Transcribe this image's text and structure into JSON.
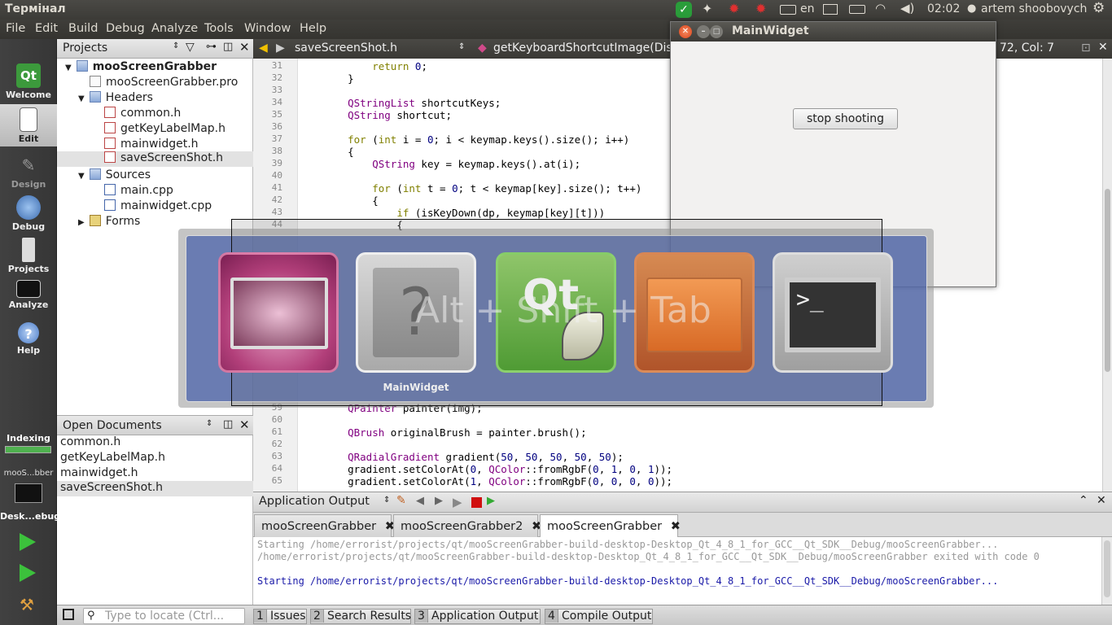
{
  "top_panel": {
    "app_title": "Термінал",
    "lang": "en",
    "time": "02:02",
    "user": "artem shoobovych"
  },
  "menu": [
    "File",
    "Edit",
    "Build",
    "Debug",
    "Analyze",
    "Tools",
    "Window",
    "Help"
  ],
  "modes": {
    "welcome": "Welcome",
    "edit": "Edit",
    "design": "Design",
    "debug": "Debug",
    "projects": "Projects",
    "analyze": "Analyze",
    "help": "Help"
  },
  "build_status": {
    "indexing": "Indexing",
    "target_project": "mooS...bber",
    "target_kit": "Desk...ebug"
  },
  "projects": {
    "title": "Projects",
    "tree": [
      {
        "label": "mooScreenGrabber"
      },
      {
        "label": "mooScreenGrabber.pro"
      },
      {
        "label": "Headers"
      },
      {
        "label": "common.h"
      },
      {
        "label": "getKeyLabelMap.h"
      },
      {
        "label": "mainwidget.h"
      },
      {
        "label": "saveScreenShot.h"
      },
      {
        "label": "Sources"
      },
      {
        "label": "main.cpp"
      },
      {
        "label": "mainwidget.cpp"
      },
      {
        "label": "Forms"
      }
    ]
  },
  "open_documents": {
    "title": "Open Documents",
    "items": [
      "common.h",
      "getKeyLabelMap.h",
      "mainwidget.h",
      "saveScreenShot.h"
    ]
  },
  "editor": {
    "file": "saveScreenShot.h",
    "symbol": "getKeyboardShortcutImage(Disp",
    "position": "72, Col: 7",
    "lines": [
      {
        "n": "31",
        "t": "        return 0;"
      },
      {
        "n": "32",
        "t": "    }"
      },
      {
        "n": "33",
        "t": ""
      },
      {
        "n": "34",
        "t": "    QStringList shortcutKeys;"
      },
      {
        "n": "35",
        "t": "    QString shortcut;"
      },
      {
        "n": "36",
        "t": ""
      },
      {
        "n": "37",
        "t": "    for (int i = 0; i < keymap.keys().size(); i++)"
      },
      {
        "n": "38",
        "t": "    {"
      },
      {
        "n": "39",
        "t": "        QString key = keymap.keys().at(i);"
      },
      {
        "n": "40",
        "t": ""
      },
      {
        "n": "41",
        "t": "        for (int t = 0; t < keymap[key].size(); t++)"
      },
      {
        "n": "42",
        "t": "        {"
      },
      {
        "n": "43",
        "t": "            if (isKeyDown(dp, keymap[key][t]))"
      },
      {
        "n": "44",
        "t": "            {"
      }
    ],
    "lines_bottom": [
      {
        "n": "59",
        "t": "    QPainter painter(img);"
      },
      {
        "n": "60",
        "t": ""
      },
      {
        "n": "61",
        "t": "    QBrush originalBrush = painter.brush();"
      },
      {
        "n": "62",
        "t": ""
      },
      {
        "n": "63",
        "t": "    QRadialGradient gradient(50, 50, 50, 50, 50);"
      },
      {
        "n": "64",
        "t": "    gradient.setColorAt(0, QColor::fromRgbF(0, 1, 0, 1));"
      },
      {
        "n": "65",
        "t": "    gradient.setColorAt(1, QColor::fromRgbF(0, 0, 0, 0));"
      }
    ]
  },
  "main_widget": {
    "title": "MainWidget",
    "button": "stop shooting"
  },
  "switcher": {
    "shortcut": "Alt + Shift + Tab",
    "selected_label": "MainWidget"
  },
  "output": {
    "title": "Application Output",
    "tabs": [
      "mooScreenGrabber",
      "mooScreenGrabber2",
      "mooScreenGrabber"
    ],
    "lines": [
      "Starting /home/errorist/projects/qt/mooScreenGrabber-build-desktop-Desktop_Qt_4_8_1_for_GCC__Qt_SDK__Debug/mooScreenGrabber...",
      "/home/errorist/projects/qt/mooScreenGrabber-build-desktop-Desktop_Qt_4_8_1_for_GCC__Qt_SDK__Debug/mooScreenGrabber exited with code 0",
      "",
      "Starting /home/errorist/projects/qt/mooScreenGrabber-build-desktop-Desktop_Qt_4_8_1_for_GCC__Qt_SDK__Debug/mooScreenGrabber..."
    ]
  },
  "statusbar": {
    "locate_placeholder": "Type to locate (Ctrl...",
    "panes": [
      {
        "num": "1",
        "label": "Issues"
      },
      {
        "num": "2",
        "label": "Search Results"
      },
      {
        "num": "3",
        "label": "Application Output"
      },
      {
        "num": "4",
        "label": "Compile Output"
      }
    ]
  }
}
